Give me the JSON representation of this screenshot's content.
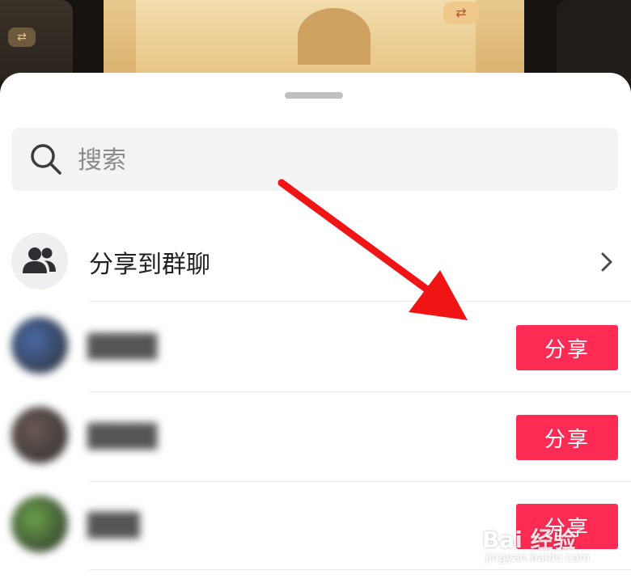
{
  "background": {
    "swap_glyph": "⇄"
  },
  "search": {
    "placeholder": "搜索"
  },
  "group_share": {
    "label": "分享到群聊"
  },
  "contacts": [
    {
      "name": "████",
      "avatar_color": "#4a6aa8",
      "share_label": "分享"
    },
    {
      "name": "████",
      "avatar_color": "#6b5a55",
      "share_label": "分享"
    },
    {
      "name": "███",
      "avatar_color": "#6aa24a",
      "share_label": "分享"
    }
  ],
  "colors": {
    "accent": "#fe2c55",
    "annotation_arrow": "#f01414"
  },
  "watermark": {
    "main": "Bai 经验",
    "sub": "jingyan.baidu.com"
  }
}
